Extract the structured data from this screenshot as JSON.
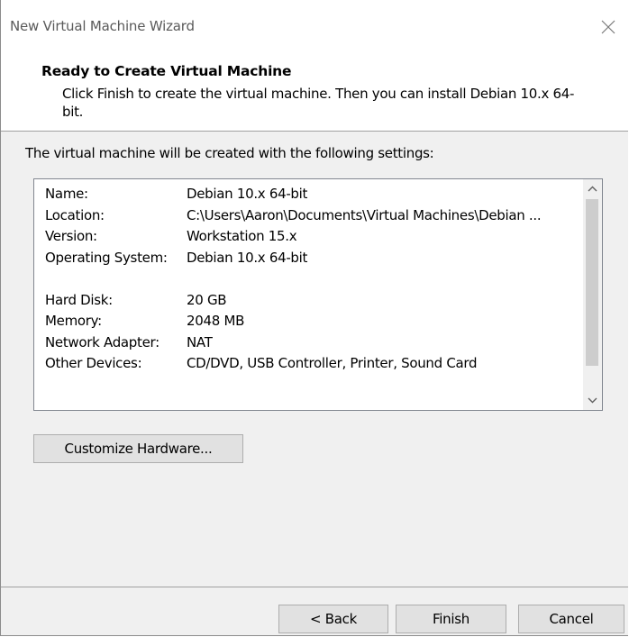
{
  "window": {
    "title": "New Virtual Machine Wizard"
  },
  "header": {
    "title": "Ready to Create Virtual Machine",
    "description": "Click Finish to create the virtual machine. Then you can install Debian 10.x 64-bit."
  },
  "content": {
    "intro": "The virtual machine will be created with the following settings:",
    "settings": [
      {
        "key": "Name:",
        "value": "Debian 10.x 64-bit"
      },
      {
        "key": "Location:",
        "value": "C:\\Users\\Aaron\\Documents\\Virtual Machines\\Debian ..."
      },
      {
        "key": "Version:",
        "value": "Workstation 15.x"
      },
      {
        "key": "Operating System:",
        "value": "Debian 10.x 64-bit"
      },
      {
        "key": "Hard Disk:",
        "value": "20 GB"
      },
      {
        "key": "Memory:",
        "value": "2048 MB"
      },
      {
        "key": "Network Adapter:",
        "value": "NAT"
      },
      {
        "key": "Other Devices:",
        "value": "CD/DVD, USB Controller, Printer, Sound Card"
      }
    ],
    "customize_label": "Customize Hardware..."
  },
  "footer": {
    "back_label": "< Back",
    "finish_label": "Finish",
    "cancel_label": "Cancel"
  },
  "icons": {
    "close": "close-icon",
    "scroll_up": "chevron-up-icon",
    "scroll_down": "chevron-down-icon"
  },
  "colors": {
    "content_bg": "#f0f0f0",
    "button_bg": "#e1e1e1",
    "button_border": "#adadad",
    "list_border": "#828790",
    "scroll_thumb": "#cdcdcd"
  }
}
